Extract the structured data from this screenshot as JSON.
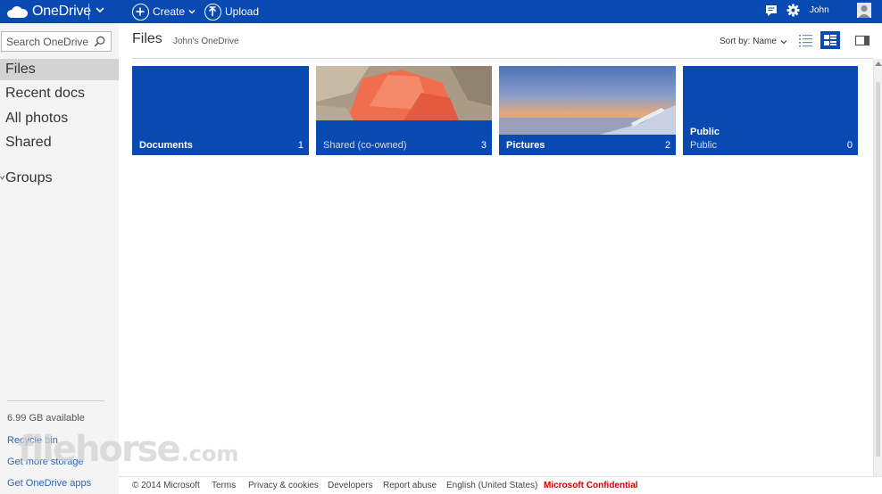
{
  "topbar": {
    "brand": "OneDrive",
    "create_label": "Create",
    "upload_label": "Upload",
    "user_name": "John",
    "icons": [
      "onedrive-cloud-icon",
      "chevron-down-icon",
      "plus-circle-icon",
      "upload-arrow-icon",
      "feedback-icon",
      "gear-icon",
      "avatar-icon"
    ]
  },
  "sidebar": {
    "search_placeholder": "Search OneDrive",
    "items": [
      {
        "label": "Files"
      },
      {
        "label": "Recent docs"
      },
      {
        "label": "All photos"
      },
      {
        "label": "Shared"
      },
      {
        "label": "Groups"
      }
    ],
    "storage": "6.99 GB available",
    "links": [
      {
        "label": "Recycle bin"
      },
      {
        "label": "Get more storage"
      },
      {
        "label": "Get OneDrive apps"
      }
    ]
  },
  "main": {
    "title": "Files",
    "breadcrumb": "John's OneDrive",
    "sort_label": "Sort by: Name",
    "tiles": [
      {
        "name": "Documents",
        "count": "1"
      },
      {
        "name": "Shared (co-owned)",
        "count": "3"
      },
      {
        "name": "Pictures",
        "count": "2"
      },
      {
        "title": "Public",
        "name": "Public",
        "count": "0"
      }
    ]
  },
  "footer": {
    "links": [
      "© 2014 Microsoft",
      "Terms",
      "Privacy & cookies",
      "Developers",
      "Report abuse",
      "English (United States)"
    ],
    "confidential": "Microsoft Confidential"
  },
  "watermark": {
    "main": "filehorse",
    "suffix": ".com"
  },
  "colors": {
    "accent": "#094ab2",
    "nav_bg": "#f4f4f4",
    "nav_active": "#d3d3d3",
    "link": "#2a64b5",
    "confidential": "#d10000"
  }
}
